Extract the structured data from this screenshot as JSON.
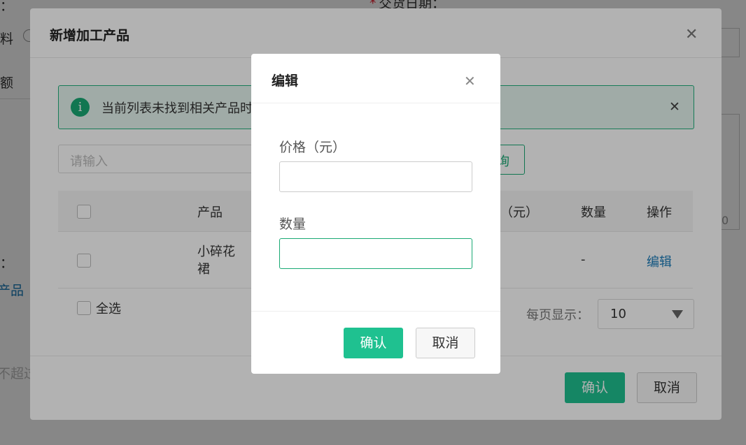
{
  "background": {
    "top_label": "：",
    "date_label": "交货日期：",
    "required_mark": "*",
    "material_label": "料",
    "amount_label": "额",
    "colon_label": "：",
    "product_link": "产品",
    "limit_hint": "不超过",
    "count_tail": "0"
  },
  "outer_modal": {
    "title": "新增加工产品",
    "alert_text": "当前列表未找到相关产品时",
    "alert_icon": "i",
    "search_placeholder": "请输入",
    "query_label": "查询",
    "query_visible": "询",
    "columns": {
      "product": "产品",
      "price": "价格（元）",
      "price_visible": "（元）",
      "quantity": "数量",
      "action": "操作"
    },
    "rows": [
      {
        "product": "小碎花裙",
        "quantity": "-",
        "action": "编辑"
      }
    ],
    "select_all": "全选",
    "page_size_label": "每页显示：",
    "page_size_value": "10",
    "confirm": "确认",
    "cancel": "取消"
  },
  "inner_modal": {
    "title": "编辑",
    "price_label": "价格（元）",
    "price_value": "",
    "quantity_label": "数量",
    "quantity_value": "",
    "confirm": "确认",
    "cancel": "取消"
  },
  "colors": {
    "accent": "#1fc190",
    "link": "#1a7bb9",
    "alert_border": "#22b07d"
  }
}
